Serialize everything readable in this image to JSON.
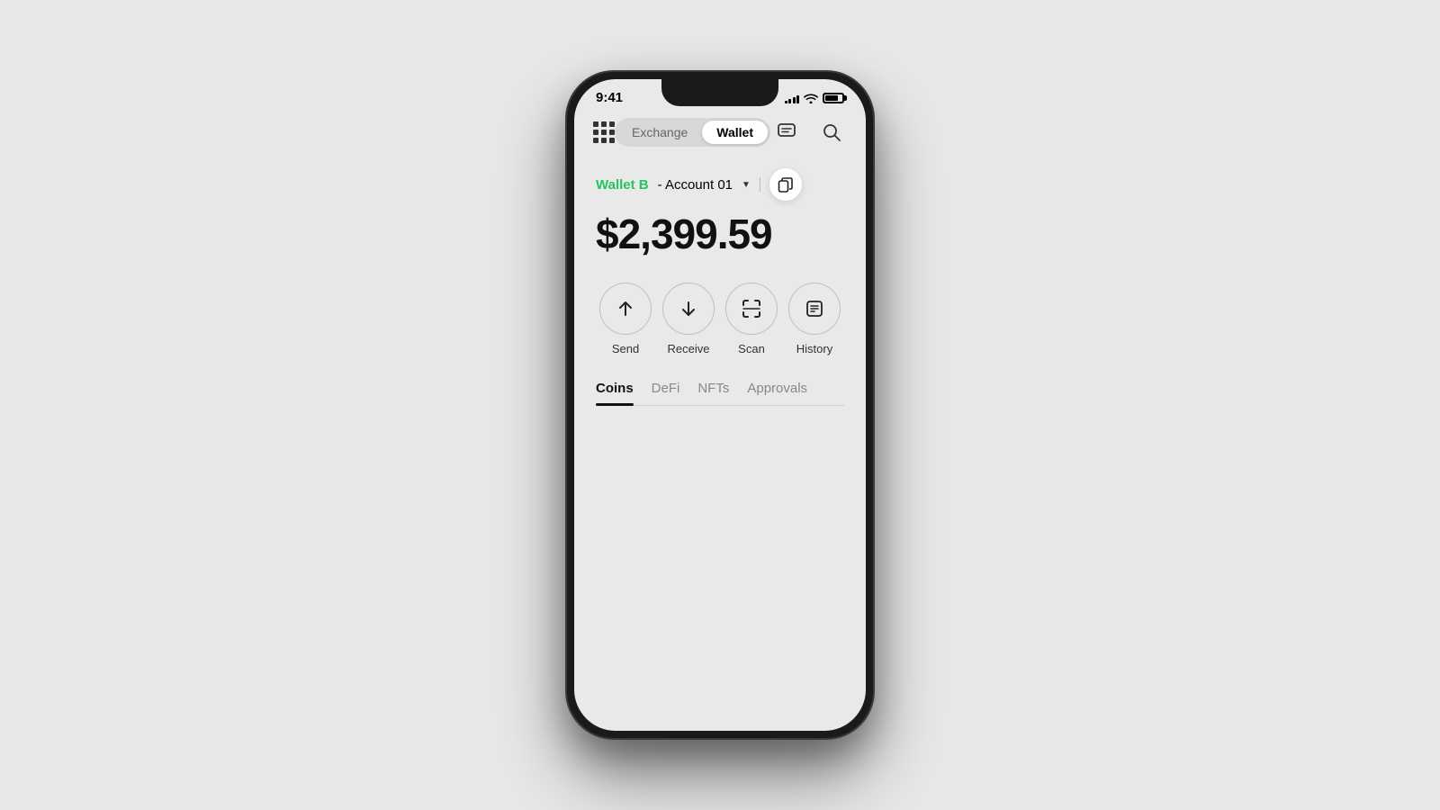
{
  "status": {
    "time": "9:41",
    "signal_bars": [
      3,
      5,
      7,
      9,
      11
    ],
    "battery_label": "battery"
  },
  "header": {
    "exchange_label": "Exchange",
    "wallet_label": "Wallet",
    "active_tab": "wallet"
  },
  "account": {
    "wallet_name": "Wallet B",
    "account_name": "- Account 01",
    "balance": "$2,399.59"
  },
  "actions": [
    {
      "id": "send",
      "label": "Send",
      "icon": "arrow-up"
    },
    {
      "id": "receive",
      "label": "Receive",
      "icon": "arrow-down"
    },
    {
      "id": "scan",
      "label": "Scan",
      "icon": "scan"
    },
    {
      "id": "history",
      "label": "History",
      "icon": "history"
    }
  ],
  "tabs": [
    {
      "id": "coins",
      "label": "Coins",
      "active": true
    },
    {
      "id": "defi",
      "label": "DeFi",
      "active": false
    },
    {
      "id": "nfts",
      "label": "NFTs",
      "active": false
    },
    {
      "id": "approvals",
      "label": "Approvals",
      "active": false
    }
  ]
}
